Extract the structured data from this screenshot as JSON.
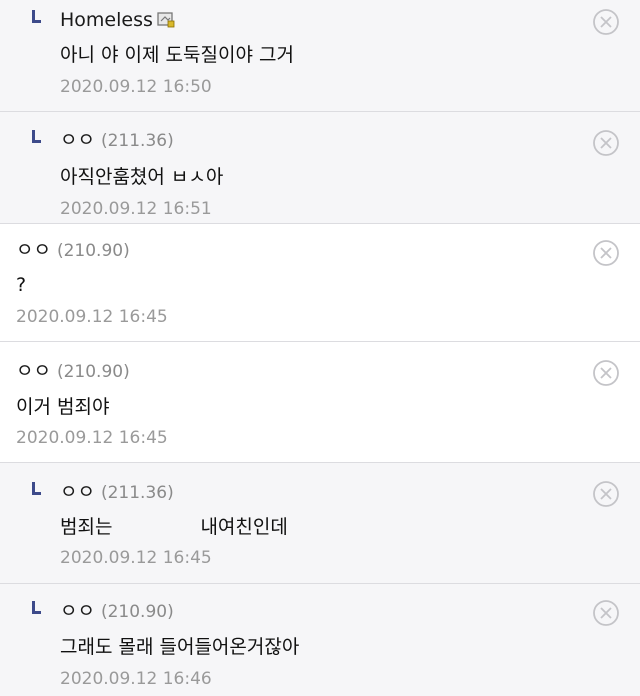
{
  "comments": [
    {
      "author": "Homeless",
      "ip": "",
      "text": "아니 야 이제 도둑질이야 그거",
      "date": "2020.09.12 16:50"
    },
    {
      "author": "ㅇㅇ",
      "ip": "(211.36)",
      "text": "아직안훔쳤어 ㅂㅅ아",
      "date": "2020.09.12 16:51"
    },
    {
      "author": "ㅇㅇ",
      "ip": "(210.90)",
      "text": "?",
      "date": "2020.09.12 16:45"
    },
    {
      "author": "ㅇㅇ",
      "ip": "(210.90)",
      "text": "이거 범죄야",
      "date": "2020.09.12 16:45"
    },
    {
      "author": "ㅇㅇ",
      "ip": "(211.36)",
      "text_a": "범죄는",
      "text_b": "내여친인데",
      "date": "2020.09.12 16:45"
    },
    {
      "author": "ㅇㅇ",
      "ip": "(210.90)",
      "text": "그래도 몰래 들어들어온거잖아",
      "date": "2020.09.12 16:46"
    }
  ],
  "icons": {
    "close": "close-circle-icon",
    "reply": "reply-arrow-icon",
    "badge": "member-badge-icon"
  },
  "colors": {
    "reply_bg": "#f6f6f8",
    "reply_mark": "#3d4a8a",
    "meta_gray": "#9a9a9a"
  }
}
